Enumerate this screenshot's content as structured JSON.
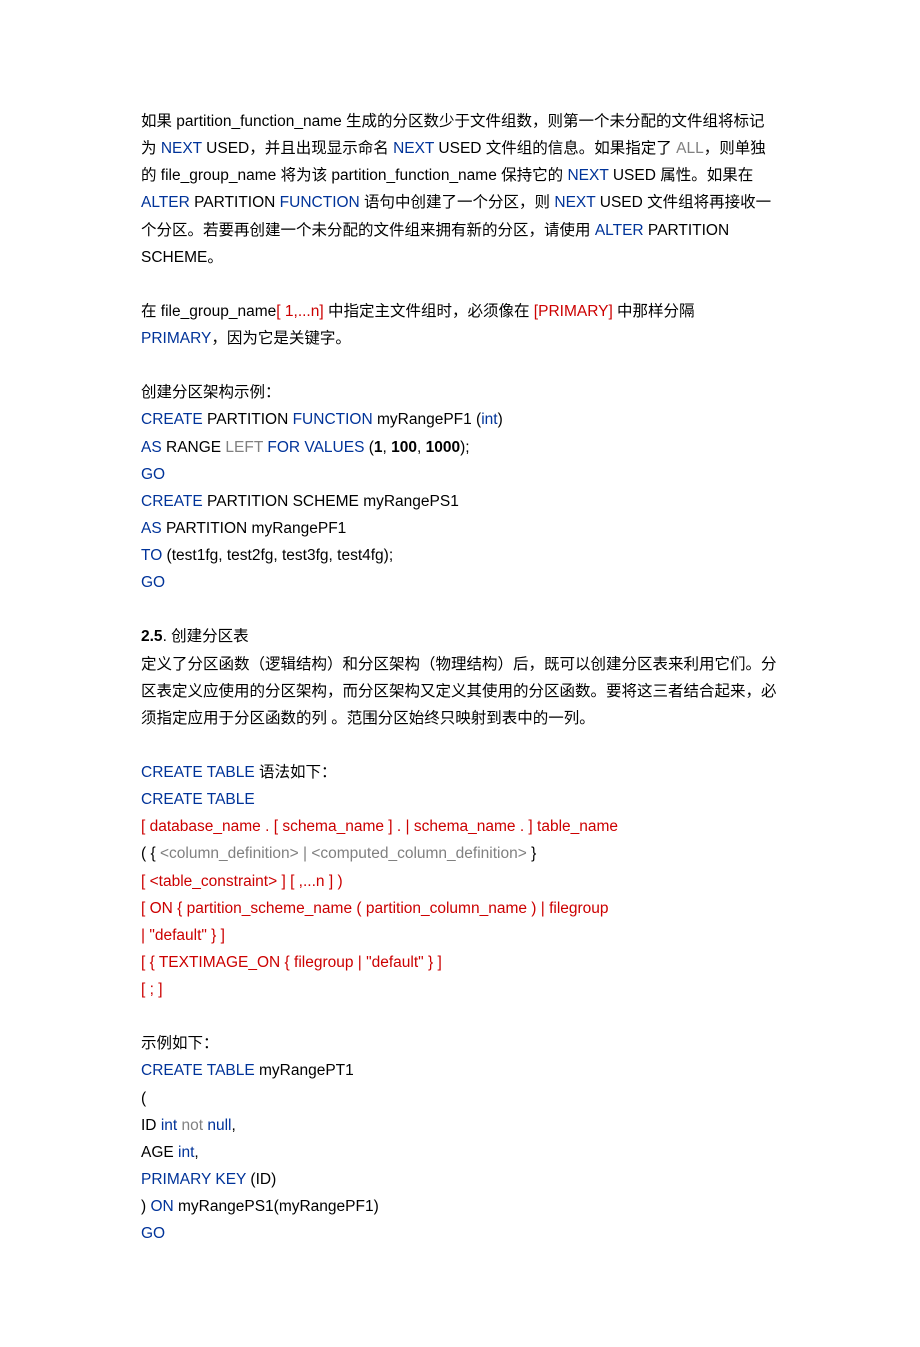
{
  "p1": {
    "t1": "如果 partition_function_name 生成的分区数少于文件组数，则第一个未分配的文件组将标记为 ",
    "t2": "NEXT",
    "t3": " USED，并且出现显示命名 ",
    "t4": "NEXT",
    "t5": " USED 文件组的信息。如果指定了 ",
    "t6": "ALL",
    "t7": "，则单独的 file_group_name 将为该 partition_function_name 保持它的 ",
    "t8": "NEXT",
    "t9": " USED 属性。如果在 ",
    "t10": "ALTER",
    "t11": " PARTITION ",
    "t12": "FUNCTION",
    "t13": " 语句中创建了一个分区，则 ",
    "t14": "NEXT",
    "t15": " USED 文件组将再接收一个分区。若要再创建一个未分配的文件组来拥有新的分区，请使用 ",
    "t16": "ALTER",
    "t17": " PARTITION SCHEME。"
  },
  "p2": {
    "t1": "在 file_group_name",
    "t2": "[ 1,...n]",
    "t3": " 中指定主文件组时，必须像在 ",
    "t4": "[PRIMARY]",
    "t5": " 中那样分隔 ",
    "t6": "PRIMARY",
    "t7": "，因为它是关键字。"
  },
  "ex1": {
    "l0": "创建分区架构示例：",
    "l1a": "CREATE",
    "l1b": " PARTITION ",
    "l1c": "FUNCTION",
    "l1d": " myRangePF1 (",
    "l1e": "int",
    "l1f": ")",
    "l2a": "AS",
    "l2b": " RANGE ",
    "l2c": "LEFT",
    "l2d": " ",
    "l2e": "FOR",
    "l2f": " ",
    "l2g": "VALUES",
    "l2h": " (",
    "l2i": "1",
    "l2j": ", ",
    "l2k": "100",
    "l2l": ", ",
    "l2m": "1000",
    "l2n": ");",
    "l3a": "GO",
    "l4a": "CREATE",
    "l4b": " PARTITION SCHEME myRangePS1",
    "l5a": "AS",
    "l5b": " PARTITION myRangePF1",
    "l6a": "TO",
    "l6b": " (test1fg, test2fg, test3fg, test4fg);",
    "l7a": "GO"
  },
  "sec25": {
    "num": "2.5",
    "title": ". 创建分区表",
    "body": "定义了分区函数（逻辑结构）和分区架构（物理结构）后，既可以创建分区表来利用它们。分区表定义应使用的分区架构，而分区架构又定义其使用的分区函数。要将这三者结合起来，必须指定应用于分区函数的列 。范围分区始终只映射到表中的一列。"
  },
  "ctable": {
    "intro1": "CREATE TABLE",
    "intro2": " 语法如下：",
    "l1": "CREATE TABLE",
    "l2": "[ database_name . [ schema_name ] . | schema_name . ] table_name",
    "l3a": "( { ",
    "l3b": "<column_definition> | <computed_column_definition>",
    "l3c": " }",
    "l4": "[ <table_constraint> ] [ ,...n ] )",
    "l5": "[ ON { partition_scheme_name ( partition_column_name ) | filegroup",
    "l6": "| \"default\" } ]",
    "l7": "[ { TEXTIMAGE_ON { filegroup | \"default\" } ]",
    "l8": "[ ; ]"
  },
  "ex2": {
    "intro": "示例如下：",
    "l1a": "CREATE TABLE",
    "l1b": " myRangePT1",
    "l2": "(",
    "l3a": "ID ",
    "l3b": "int",
    "l3c": " ",
    "l3d": "not",
    "l3e": " ",
    "l3f": "null",
    "l3g": ",",
    "l4a": "AGE ",
    "l4b": "int",
    "l4c": ",",
    "l5a": "PRIMARY KEY",
    "l5b": " (ID)",
    "l6a": ") ",
    "l6b": "ON",
    "l6c": " myRangePS1(myRangePF1)",
    "l7": "GO"
  }
}
